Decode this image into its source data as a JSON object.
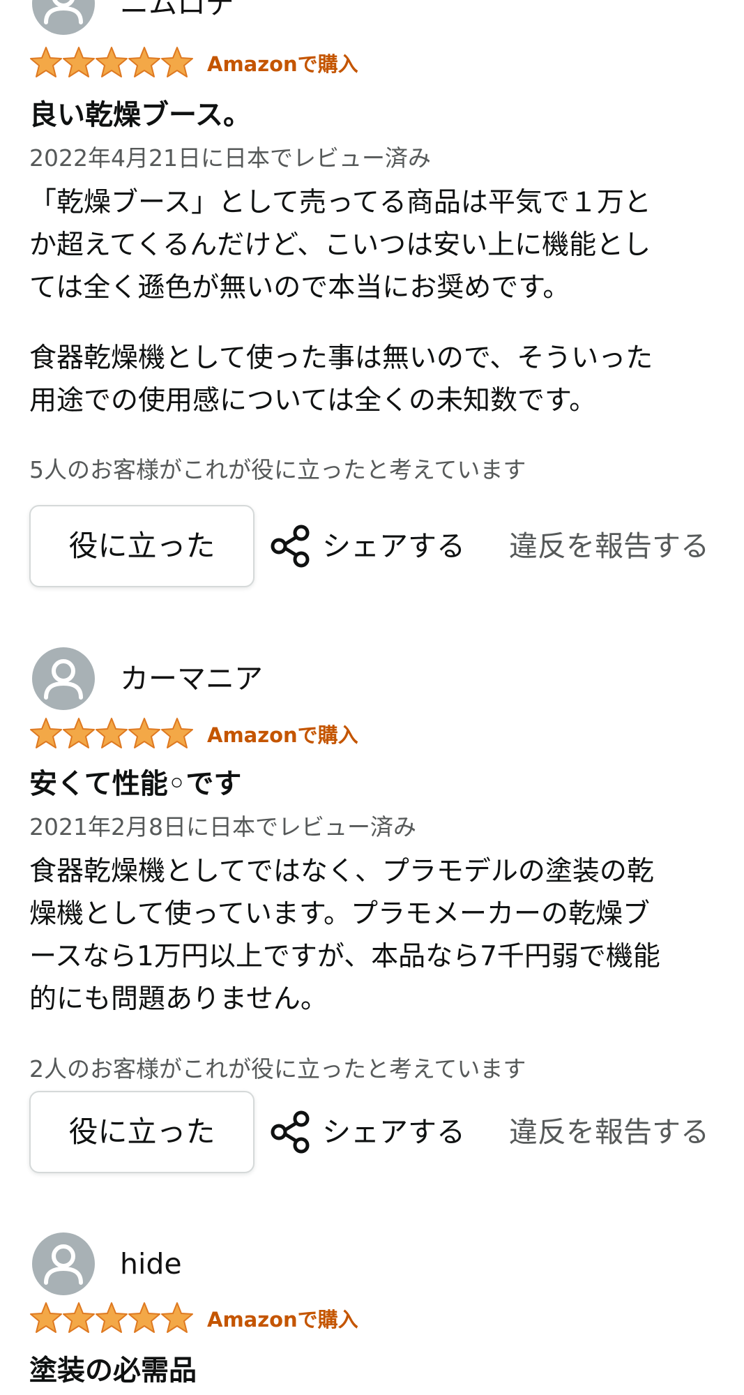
{
  "reviews": [
    {
      "reviewer": "ニムロデ",
      "rating": 5,
      "verified_label": "Amazonで購入",
      "title": "良い乾燥ブース。",
      "date": "2022年4月21日に日本でレビュー済み",
      "body_paragraphs": [
        [
          "「乾燥ブース」として売ってる商品は平気で１万と",
          "か超えてくるんだけど、こいつは安い上に機能とし",
          "ては全く遜色が無いので本当にお奨めです。"
        ],
        [
          "食器乾燥機として使った事は無いので、そういった",
          "用途での使用感については全くの未知数です。"
        ]
      ],
      "helpful_count": "5人のお客様がこれが役に立ったと考えています",
      "helpful_button": "役に立った",
      "share_label": "シェアする",
      "report_label": "違反を報告する"
    },
    {
      "reviewer": "カーマニア",
      "rating": 5,
      "verified_label": "Amazonで購入",
      "title": "安くて性能◦です",
      "date": "2021年2月8日に日本でレビュー済み",
      "body_paragraphs": [
        [
          "食器乾燥機としてではなく、プラモデルの塗装の乾",
          "燥機として使っています。プラモメーカーの乾燥ブ",
          "ースなら1万円以上ですが、本品なら7千円弱で機能",
          "的にも問題ありません。"
        ]
      ],
      "helpful_count": "2人のお客様がこれが役に立ったと考えています",
      "helpful_button": "役に立った",
      "share_label": "シェアする",
      "report_label": "違反を報告する"
    },
    {
      "reviewer": "hide",
      "rating": 5,
      "verified_label": "Amazonで購入",
      "title": "塗装の必需品"
    }
  ],
  "colors": {
    "star": "#f3a847",
    "star_outline": "#de7921",
    "verified": "#c45500",
    "avatar_bg": "#a8b1b5",
    "secondary_text": "#565959"
  },
  "icons": {
    "avatar": "default-user-avatar-icon",
    "star": "star-icon",
    "share": "share-icon"
  }
}
